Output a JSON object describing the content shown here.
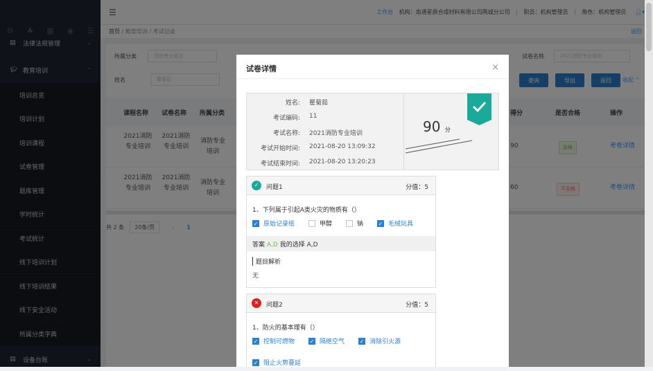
{
  "sidebar": {
    "items": [
      {
        "label": "法律法规管理",
        "type": "group"
      },
      {
        "label": "教育培训",
        "type": "group"
      },
      {
        "label": "培训总览",
        "type": "sub"
      },
      {
        "label": "培训计划",
        "type": "sub"
      },
      {
        "label": "培训课程",
        "type": "sub"
      },
      {
        "label": "试卷管理",
        "type": "sub"
      },
      {
        "label": "题库管理",
        "type": "sub"
      },
      {
        "label": "学时统计",
        "type": "sub"
      },
      {
        "label": "考试统计",
        "type": "sub"
      },
      {
        "label": "线下培训计划",
        "type": "sub"
      },
      {
        "label": "线下培训结果",
        "type": "sub"
      },
      {
        "label": "线下安全活动",
        "type": "sub"
      },
      {
        "label": "所属分类字典",
        "type": "sub"
      },
      {
        "label": "设备台账",
        "type": "group"
      }
    ]
  },
  "topbar": {
    "workbench": "工作台",
    "org": "机构：南通星辰合成材料有限公司两城分公司",
    "position": "职员：机构管理员",
    "role": "角色：机构管理员"
  },
  "breadcrumb": {
    "home": "首页",
    "section": "教育培训",
    "current": "考试记录",
    "back": "返回"
  },
  "filters": {
    "category_label": "所属分类",
    "category_placeholder": "消防专业培训",
    "exam_label": "试卷名称",
    "exam_placeholder": "2021消防专业培训",
    "name_label": "姓名",
    "name_placeholder": "瞿菊茹",
    "search": "查询",
    "export": "导出",
    "back": "返回",
    "collapse": "收起"
  },
  "table": {
    "headers": [
      "课程名称",
      "试卷名称",
      "所属分类",
      "得分",
      "是否合格",
      "操作"
    ],
    "rows": [
      {
        "course": "2021消防专业培训",
        "exam": "2021消防专业培训",
        "category": "消防专业培训",
        "score": "90",
        "status": "及格",
        "action": "考卷详情"
      },
      {
        "course": "2021消防专业培训",
        "exam": "2021消防专业培训",
        "category": "消防专业培训",
        "score": "60",
        "status": "不及格",
        "action": "考卷详情"
      }
    ]
  },
  "pager": {
    "total": "共 2 条",
    "size": "20条/页",
    "page": "1"
  },
  "dialog": {
    "title": "试卷详情",
    "info": [
      {
        "label": "姓名:",
        "value": "瞿菊茹"
      },
      {
        "label": "考试编码:",
        "value": "11"
      },
      {
        "label": "考试名称:",
        "value": "2021消防专业培训"
      },
      {
        "label": "考试开始时间:",
        "value": "2021-08-20 13:09:32"
      },
      {
        "label": "考试结束时间:",
        "value": "2021-08-20 13:20:23"
      }
    ],
    "score": "90",
    "score_unit": "分",
    "questions": [
      {
        "title": "问题1",
        "points": "分值：5",
        "correct": true,
        "text": "1、下列属于引起A类火灾的物质有（）",
        "options": [
          {
            "label": "原始记录纸",
            "checked": true
          },
          {
            "label": "甲醇",
            "checked": false
          },
          {
            "label": "钠",
            "checked": false
          },
          {
            "label": "毛绒玩具",
            "checked": true
          }
        ],
        "answer_label": "答案",
        "answer": "A,D",
        "my_label": "我的选择",
        "my": "A,D",
        "analysis_label": "题目解析",
        "analysis": "无"
      },
      {
        "title": "问题2",
        "points": "分值：5",
        "correct": false,
        "text": "1、防火的基本理有（）",
        "options": [
          {
            "label": "控制可燃物",
            "checked": true
          },
          {
            "label": "隔绝空气",
            "checked": true
          },
          {
            "label": "消除引火源",
            "checked": true
          },
          {
            "label": "阻止火势蔓延",
            "checked": true
          }
        ]
      }
    ]
  },
  "colors": {
    "sidebar": "#1f2430",
    "primary": "#2d7fd0",
    "pass": "#67c23a",
    "fail": "#f56c6c",
    "badge": "#1aaa9a"
  }
}
